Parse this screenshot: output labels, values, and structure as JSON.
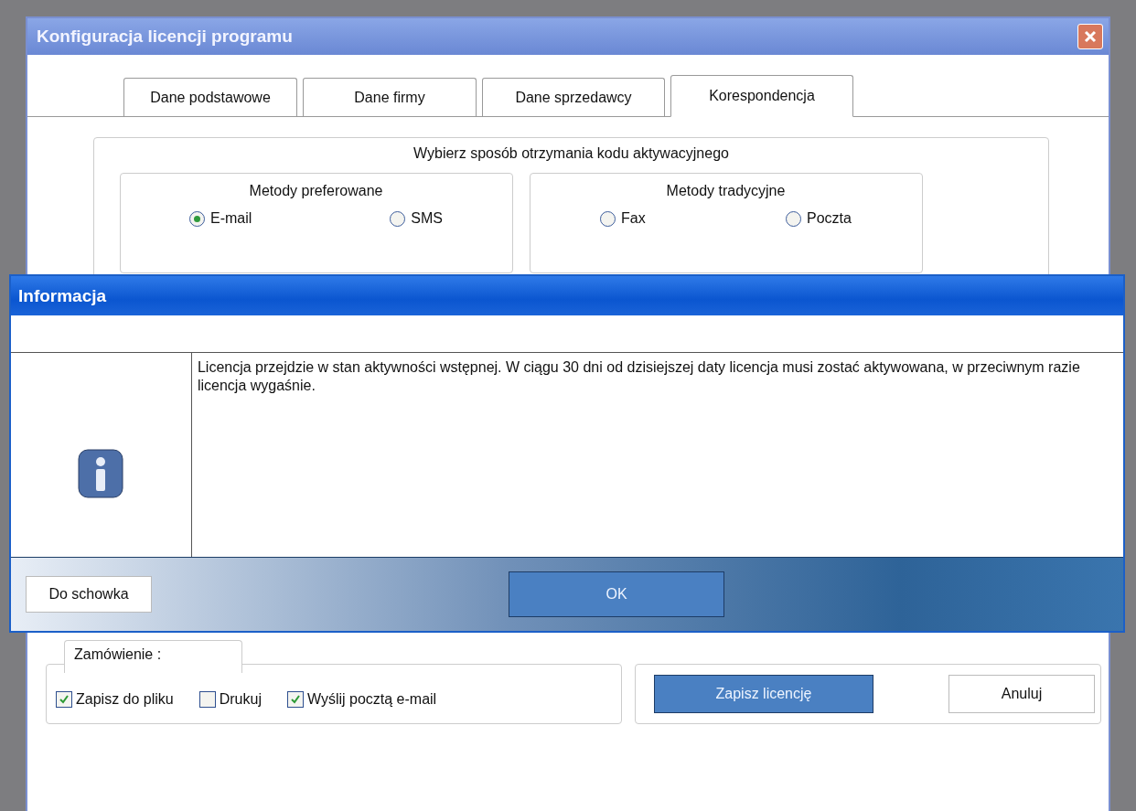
{
  "window": {
    "title": "Konfiguracja licencji programu"
  },
  "tabs": [
    {
      "label": "Dane podstawowe",
      "selected": false
    },
    {
      "label": "Dane firmy",
      "selected": false
    },
    {
      "label": "Dane sprzedawcy",
      "selected": false
    },
    {
      "label": "Korespondencja",
      "selected": true
    }
  ],
  "activation": {
    "title": "Wybierz sposób otrzymania kodu aktywacyjnego",
    "groups": [
      {
        "title": "Metody preferowane",
        "options": [
          {
            "label": "E-mail",
            "selected": true
          },
          {
            "label": "SMS",
            "selected": false
          }
        ]
      },
      {
        "title": "Metody tradycyjne",
        "options": [
          {
            "label": "Fax",
            "selected": false
          },
          {
            "label": "Poczta",
            "selected": false
          }
        ]
      }
    ]
  },
  "order": {
    "title": "Zamówienie :",
    "checkboxes": [
      {
        "label": "Zapisz do pliku",
        "checked": true
      },
      {
        "label": "Drukuj",
        "checked": false
      },
      {
        "label": "Wyślij pocztą e-mail",
        "checked": true
      }
    ]
  },
  "buttons": [
    {
      "label": "Zapisz licencję",
      "kind": "primary"
    },
    {
      "label": "Anuluj",
      "kind": "normal"
    }
  ],
  "dialog": {
    "title": "Informacja",
    "message": "Licencja przejdzie w stan aktywności wstępnej. W ciągu 30 dni od dzisiejszej daty licencja musi zostać aktywowana, w przeciwnym razie licencja wygaśnie.",
    "buttons": [
      {
        "label": "Do schowka",
        "kind": "normal"
      },
      {
        "label": "OK",
        "kind": "primary"
      }
    ]
  }
}
